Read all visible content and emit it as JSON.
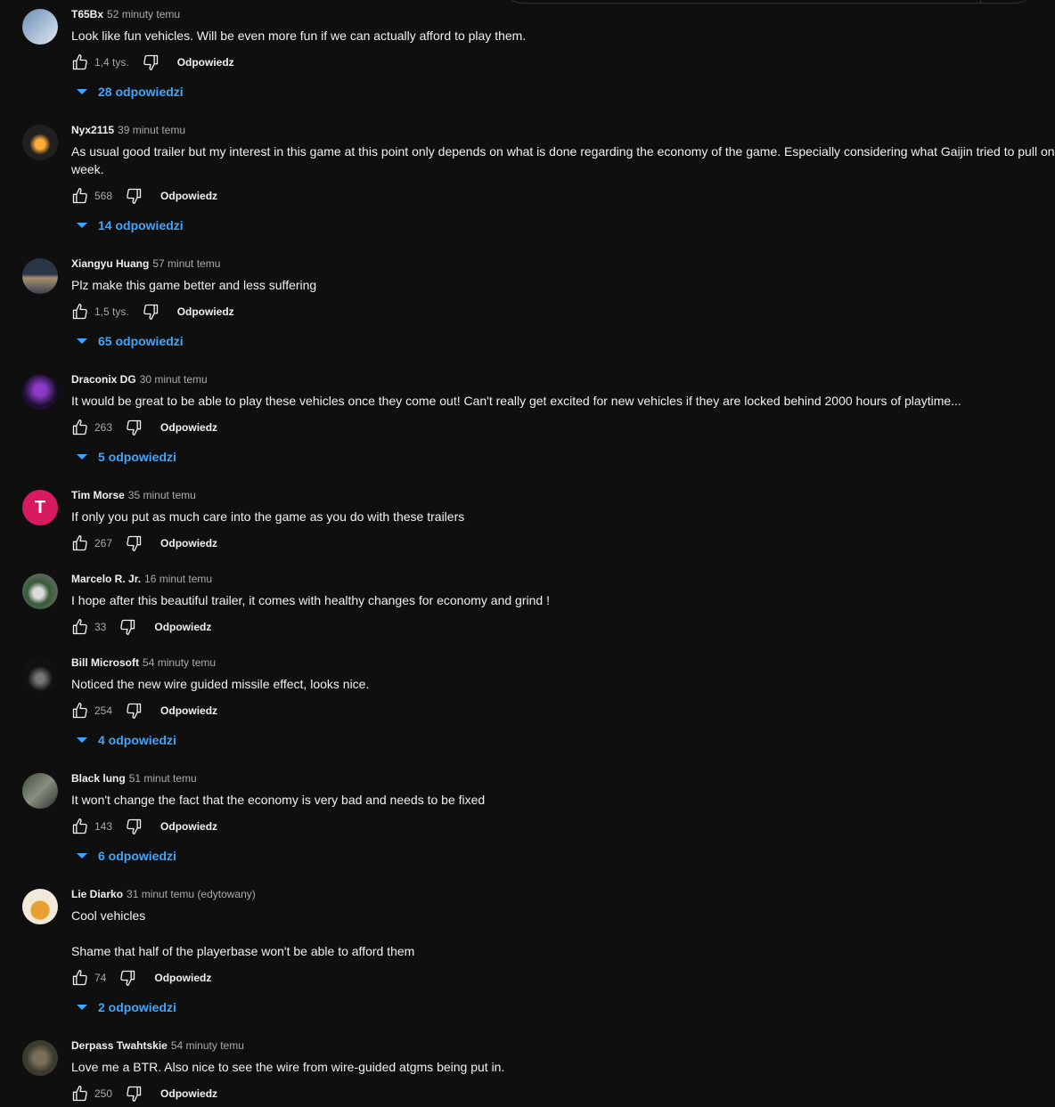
{
  "comments": [
    {
      "author": "T65Bx",
      "time": "52 minuty temu",
      "text": "Look like fun vehicles. Will be even more fun if we can actually afford to play them.",
      "likes": "1,4 tys.",
      "reply_label": "Odpowiedz",
      "replies": "28 odpowiedzi",
      "avatar_letter": ""
    },
    {
      "author": "Nyx2115",
      "time": "39 minut temu",
      "text": "As usual good trailer but my interest in this game at this point only depends on what is done regarding the economy of the game. Especially considering what Gaijin tried to pull on\nweek.",
      "likes": "568",
      "reply_label": "Odpowiedz",
      "replies": "14 odpowiedzi",
      "avatar_letter": ""
    },
    {
      "author": "Xiangyu Huang",
      "time": "57 minut temu",
      "text": "Plz make this game better and less suffering",
      "likes": "1,5 tys.",
      "reply_label": "Odpowiedz",
      "replies": "65 odpowiedzi",
      "avatar_letter": ""
    },
    {
      "author": "Draconix DG",
      "time": "30 minut temu",
      "text": "It would be great to be able to play these vehicles once they come out! Can't really get excited for new vehicles if they are locked behind 2000 hours of playtime...",
      "likes": "263",
      "reply_label": "Odpowiedz",
      "replies": "5 odpowiedzi",
      "avatar_letter": ""
    },
    {
      "author": "Tim Morse",
      "time": "35 minut temu",
      "text": "If only you put as much care into the game as you do with these trailers",
      "likes": "267",
      "reply_label": "Odpowiedz",
      "replies": "",
      "avatar_letter": "T"
    },
    {
      "author": "Marcelo R. Jr.",
      "time": "16 minut temu",
      "text": "I hope after this beautiful trailer, it comes with healthy changes for economy and grind !",
      "likes": "33",
      "reply_label": "Odpowiedz",
      "replies": "",
      "avatar_letter": ""
    },
    {
      "author": "Bill Microsoft",
      "time": "54 minuty temu",
      "text": "Noticed the new wire guided missile effect, looks nice.",
      "likes": "254",
      "reply_label": "Odpowiedz",
      "replies": "4 odpowiedzi",
      "avatar_letter": ""
    },
    {
      "author": "Black lung",
      "time": "51 minut temu",
      "text": "It won't change the fact that the economy is very bad and needs to be fixed",
      "likes": "143",
      "reply_label": "Odpowiedz",
      "replies": "6 odpowiedzi",
      "avatar_letter": ""
    },
    {
      "author": "Lie Diarko",
      "time": "31 minut temu (edytowany)",
      "text": "Cool vehicles\n\nShame that half of the playerbase won't be able to afford them",
      "likes": "74",
      "reply_label": "Odpowiedz",
      "replies": "2 odpowiedzi",
      "avatar_letter": ""
    },
    {
      "author": "Derpass Twahtskie",
      "time": "54 minuty temu",
      "text": "Love me a BTR. Also nice to see the wire from wire-guided atgms being put in.",
      "likes": "250",
      "reply_label": "Odpowiedz",
      "replies": "",
      "avatar_letter": ""
    }
  ],
  "colors": {
    "background": "#0f0f0f",
    "link": "#3ea6ff",
    "muted": "#aaaaaa"
  }
}
